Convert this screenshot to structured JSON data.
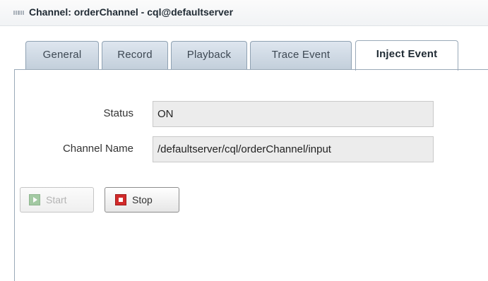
{
  "header": {
    "title": "Channel: orderChannel - cql@defaultserver",
    "icon": "drag-grip-icon"
  },
  "tabs": [
    {
      "label": "General",
      "active": false
    },
    {
      "label": "Record",
      "active": false
    },
    {
      "label": "Playback",
      "active": false
    },
    {
      "label": "Trace Event",
      "active": false
    },
    {
      "label": "Inject Event",
      "active": true
    }
  ],
  "form": {
    "status_label": "Status",
    "status_value": "ON",
    "channel_name_label": "Channel Name",
    "channel_name_value": "/defaultserver/cql/orderChannel/input"
  },
  "actions": {
    "start_label": "Start",
    "start_enabled": false,
    "start_icon": "play-icon",
    "stop_label": "Stop",
    "stop_enabled": true,
    "stop_icon": "stop-icon"
  },
  "colors": {
    "tab_gradient_top": "#dee6ef",
    "tab_gradient_bottom": "#c3cfdb",
    "stop_red": "#d12a2a",
    "start_green": "#6dad6d"
  }
}
